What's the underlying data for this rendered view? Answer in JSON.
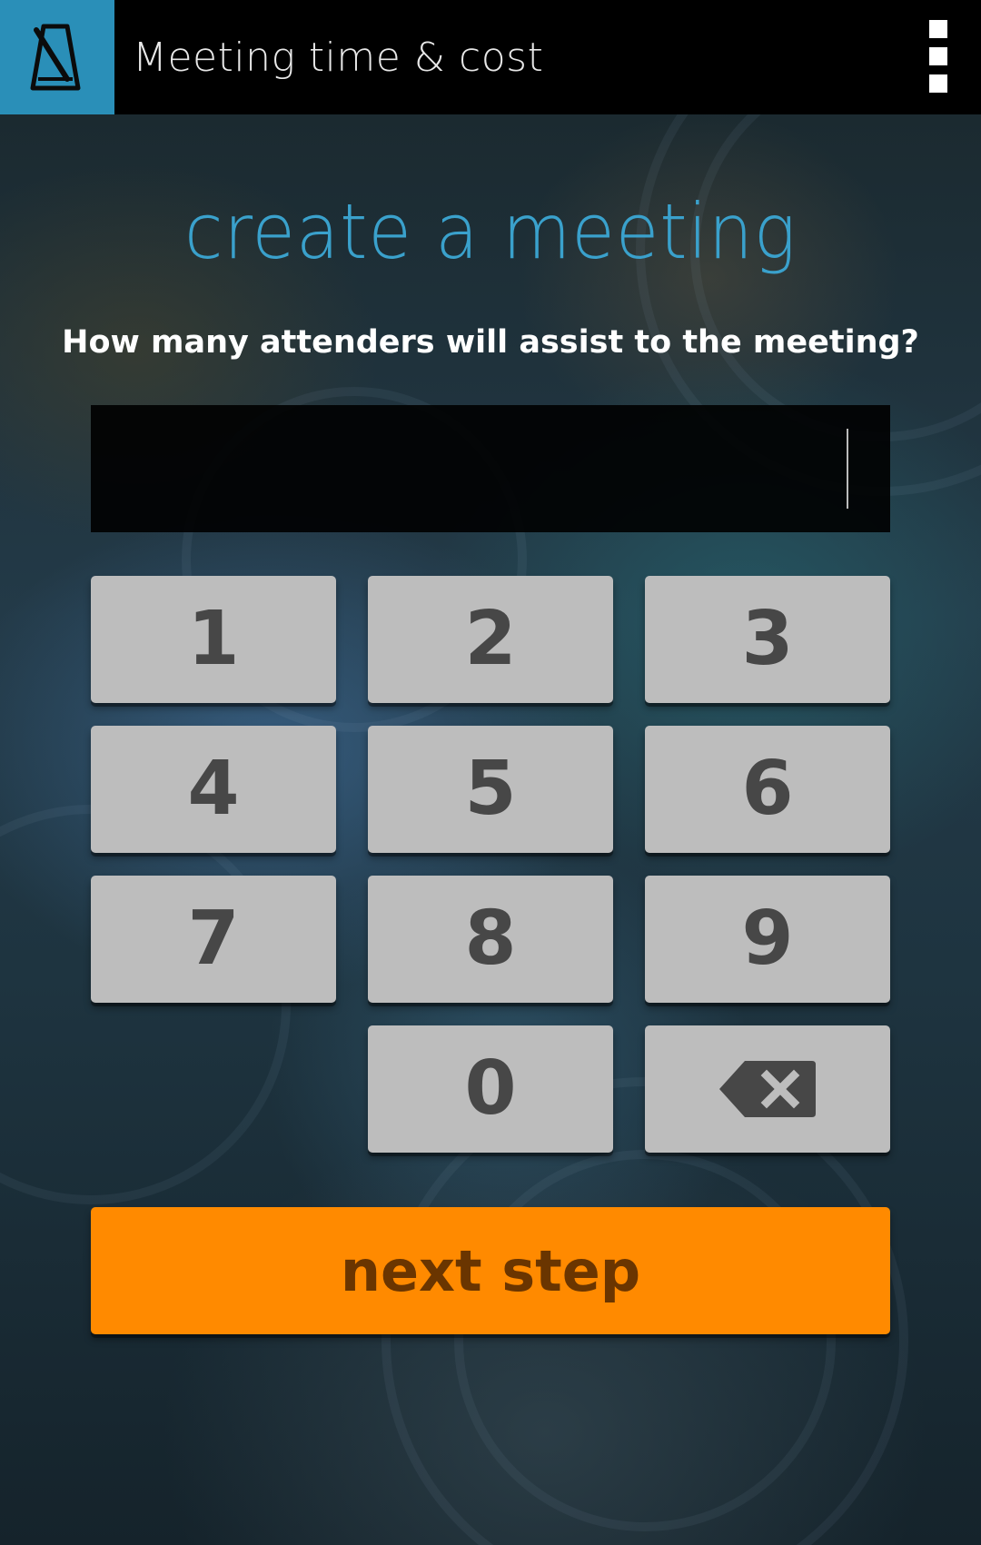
{
  "app_bar": {
    "title": "Meeting time & cost",
    "logo_icon": "metronome-icon",
    "menu_icon": "overflow-menu-icon",
    "background_color": "#000000",
    "logo_background_color": "#2a8fb8"
  },
  "main": {
    "heading": "create a meeting",
    "heading_color": "#3aa1cc",
    "question": "How many attenders will assist to the meeting?",
    "attenders_input": {
      "value": "",
      "placeholder": ""
    }
  },
  "keypad": {
    "keys": [
      "1",
      "2",
      "3",
      "4",
      "5",
      "6",
      "7",
      "8",
      "9",
      "0"
    ],
    "backspace_icon": "backspace-icon",
    "key_color": "#bdbdbd"
  },
  "next_button": {
    "label": "next step",
    "color": "#ff8a00"
  }
}
